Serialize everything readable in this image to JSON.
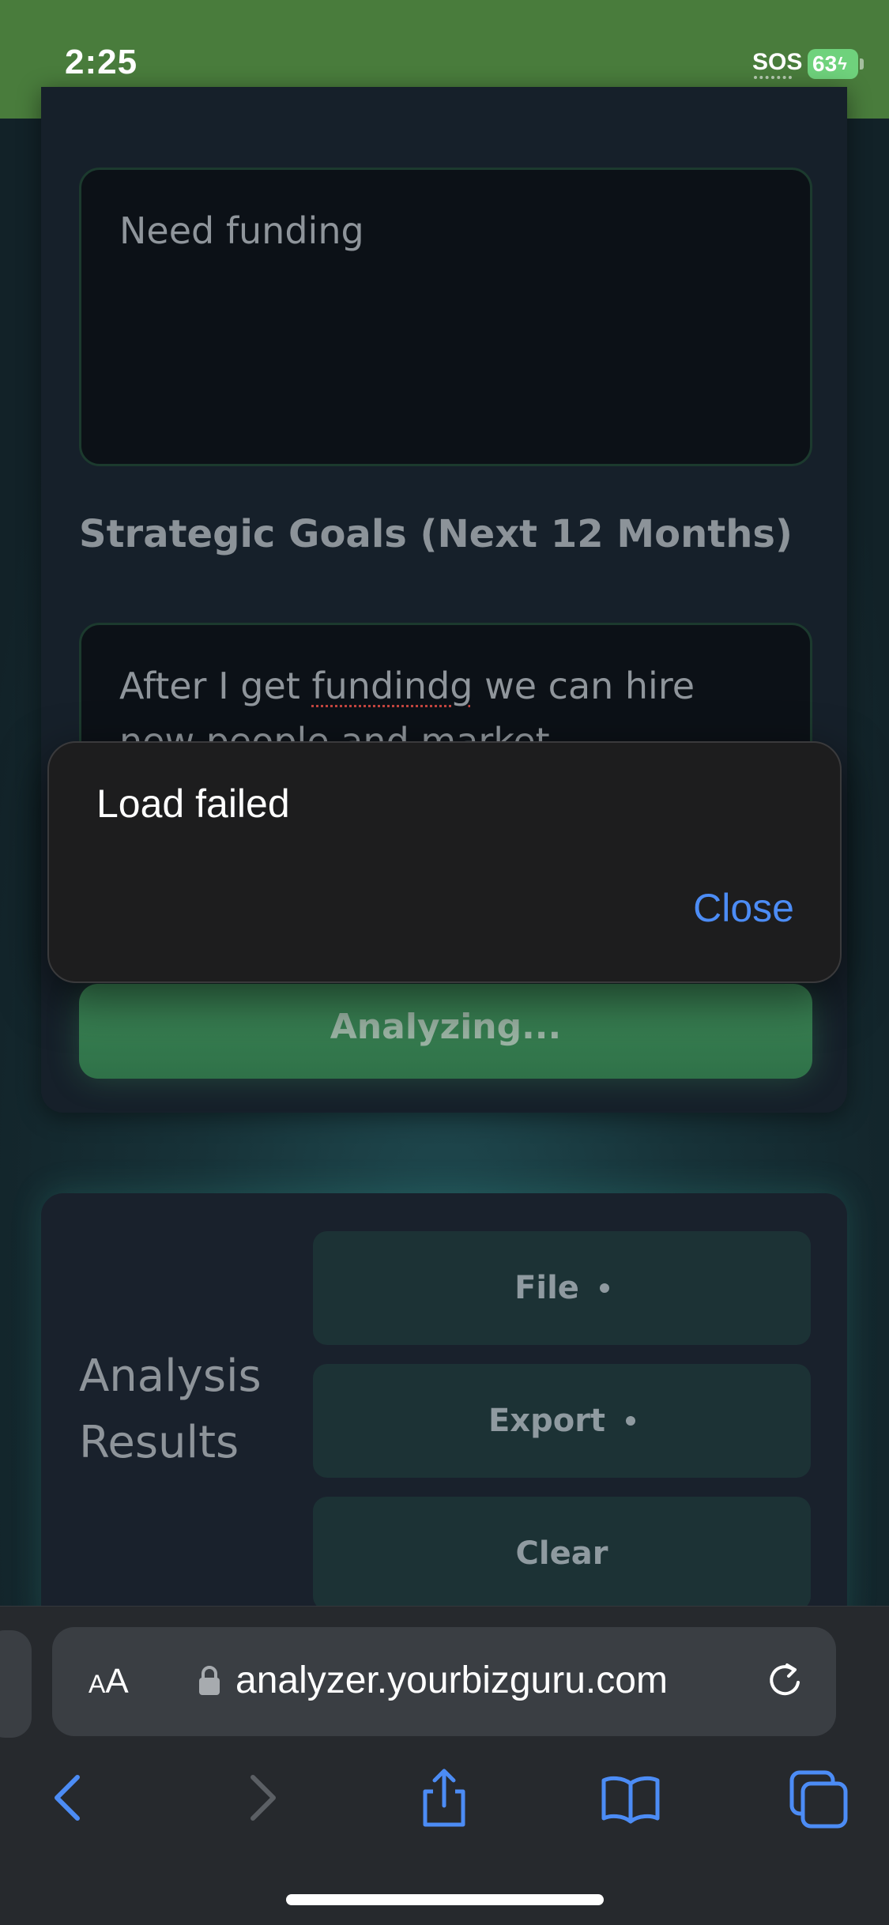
{
  "status_bar": {
    "time": "2:25",
    "sos": "SOS",
    "battery": "63"
  },
  "form": {
    "challenges_value": "Need funding",
    "goals_label": "Strategic Goals (Next 12 Months)",
    "goals_value_pre": "After I get ",
    "goals_value_misspelled": "fundindg",
    "goals_value_post": " we can hire new people and market",
    "analyze_button": "Analyzing..."
  },
  "results": {
    "title": "Analysis Results",
    "file_button": "File",
    "export_button": "Export",
    "clear_button": "Clear"
  },
  "alert": {
    "message": "Load failed",
    "close_button": "Close"
  },
  "safari": {
    "aa_small": "A",
    "aa_big": "A",
    "url": "analyzer.yourbizguru.com"
  },
  "colors": {
    "status_bar": "#497c3c",
    "accent_link": "#4c8cf5",
    "primary_button": "#3d8858"
  },
  "icons": [
    "lock-icon",
    "reload-icon",
    "back-icon",
    "forward-icon",
    "share-icon",
    "bookmarks-icon",
    "tabs-icon"
  ]
}
